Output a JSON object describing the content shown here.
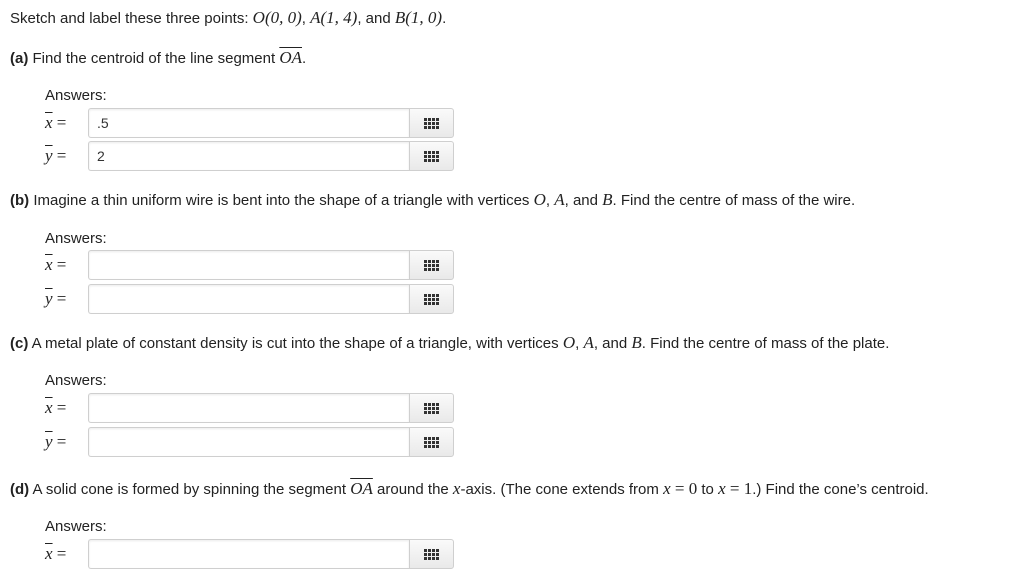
{
  "intro": {
    "text_before": "Sketch and label these three points: ",
    "point_o": "O(0, 0)",
    "sep1": ", ",
    "point_a": "A(1, 4)",
    "sep2": ", and ",
    "point_b": "B(1, 0)",
    "end": "."
  },
  "part_a": {
    "label": "(a)",
    "text": " Find the centroid of the line segment ",
    "segment": "OA",
    "end": ".",
    "answers_label": "Answers:",
    "x_var": "x",
    "y_var": "y",
    "equals": " =",
    "x_value": ".5",
    "y_value": "2"
  },
  "part_b": {
    "label": "(b)",
    "text1": " Imagine a thin uniform wire is bent into the shape of a triangle with vertices ",
    "o": "O",
    "sep1": ", ",
    "a": "A",
    "sep2": ", and ",
    "b": "B",
    "text2": ". Find the centre of mass of the wire.",
    "answers_label": "Answers:",
    "x_var": "x",
    "y_var": "y",
    "equals": " =",
    "x_value": "",
    "y_value": ""
  },
  "part_c": {
    "label": "(c)",
    "text1": " A metal plate of constant density is cut into the shape of a triangle, with vertices ",
    "o": "O",
    "sep1": ", ",
    "a": "A",
    "sep2": ", and ",
    "b": "B",
    "text2": ". Find the centre of mass of the plate.",
    "answers_label": "Answers:",
    "x_var": "x",
    "y_var": "y",
    "equals": " =",
    "x_value": "",
    "y_value": ""
  },
  "part_d": {
    "label": "(d)",
    "text1": " A solid cone is formed by spinning the segment ",
    "segment": "OA",
    "text2": " around the ",
    "axis": "x",
    "text3": "-axis. (The cone extends from ",
    "cond1_var": "x",
    "cond1_rest": " = 0",
    "text4": " to ",
    "cond2_var": "x",
    "cond2_rest": " = 1",
    "text5": ".) Find the cone’s centroid.",
    "answers_label": "Answers:",
    "x_var": "x",
    "equals": " =",
    "x_value": ""
  },
  "icons": {
    "keyboard_button": "grid-icon"
  }
}
